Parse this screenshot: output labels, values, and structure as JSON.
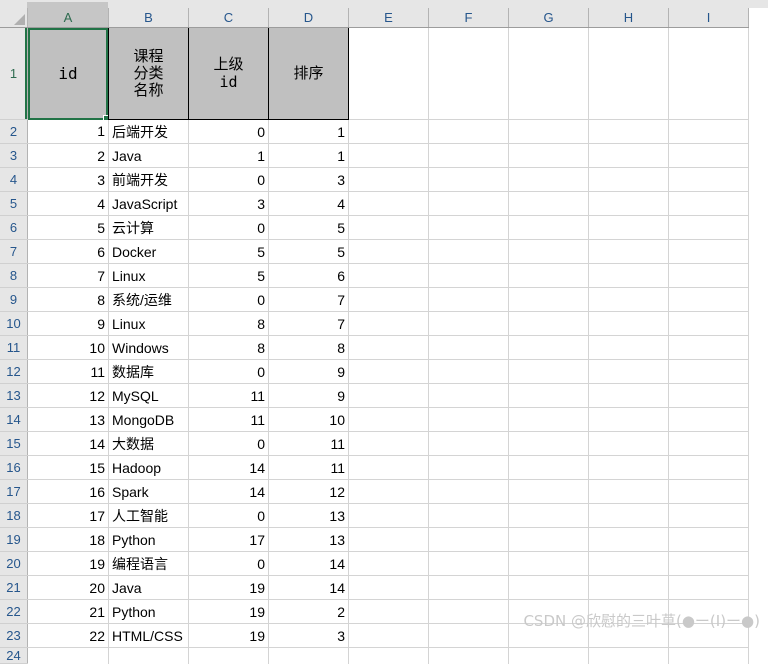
{
  "spreadsheet": {
    "select_all_icon": "select-all-triangle",
    "column_letters": [
      "A",
      "B",
      "C",
      "D",
      "E",
      "F",
      "G",
      "H",
      "I"
    ],
    "selected_column": "A",
    "selected_cell": "A1",
    "row_numbers": [
      "1",
      "2",
      "3",
      "4",
      "5",
      "6",
      "7",
      "8",
      "9",
      "10",
      "11",
      "12",
      "13",
      "14",
      "15",
      "16",
      "17",
      "18",
      "19",
      "20",
      "21",
      "22",
      "23",
      "24"
    ],
    "headers": {
      "a": "id",
      "b_lines": [
        "课程",
        "分类",
        "名称"
      ],
      "c_lines": [
        "上级",
        "id"
      ],
      "d_lines": [
        "排序"
      ]
    },
    "rows": [
      {
        "id": "1",
        "name": "后端开发",
        "parent_id": "0",
        "sort": "1"
      },
      {
        "id": "2",
        "name": "Java",
        "parent_id": "1",
        "sort": "1"
      },
      {
        "id": "3",
        "name": "前端开发",
        "parent_id": "0",
        "sort": "3"
      },
      {
        "id": "4",
        "name": "JavaScript",
        "parent_id": "3",
        "sort": "4"
      },
      {
        "id": "5",
        "name": "云计算",
        "parent_id": "0",
        "sort": "5"
      },
      {
        "id": "6",
        "name": "Docker",
        "parent_id": "5",
        "sort": "5"
      },
      {
        "id": "7",
        "name": "Linux",
        "parent_id": "5",
        "sort": "6"
      },
      {
        "id": "8",
        "name": "系统/运维",
        "parent_id": "0",
        "sort": "7"
      },
      {
        "id": "9",
        "name": "Linux",
        "parent_id": "8",
        "sort": "7"
      },
      {
        "id": "10",
        "name": "Windows",
        "parent_id": "8",
        "sort": "8"
      },
      {
        "id": "11",
        "name": "数据库",
        "parent_id": "0",
        "sort": "9"
      },
      {
        "id": "12",
        "name": "MySQL",
        "parent_id": "11",
        "sort": "9"
      },
      {
        "id": "13",
        "name": "MongoDB",
        "parent_id": "11",
        "sort": "10"
      },
      {
        "id": "14",
        "name": "大数据",
        "parent_id": "0",
        "sort": "11"
      },
      {
        "id": "15",
        "name": "Hadoop",
        "parent_id": "14",
        "sort": "11"
      },
      {
        "id": "16",
        "name": "Spark",
        "parent_id": "14",
        "sort": "12"
      },
      {
        "id": "17",
        "name": "人工智能",
        "parent_id": "0",
        "sort": "13"
      },
      {
        "id": "18",
        "name": "Python",
        "parent_id": "17",
        "sort": "13"
      },
      {
        "id": "19",
        "name": "编程语言",
        "parent_id": "0",
        "sort": "14"
      },
      {
        "id": "20",
        "name": "Java",
        "parent_id": "19",
        "sort": "14"
      },
      {
        "id": "21",
        "name": "Python",
        "parent_id": "19",
        "sort": "2"
      },
      {
        "id": "22",
        "name": "HTML/CSS",
        "parent_id": "19",
        "sort": "3"
      }
    ]
  },
  "watermark": {
    "text": "CSDN @欣慰的三叶草(●ー(I)ー●)"
  }
}
